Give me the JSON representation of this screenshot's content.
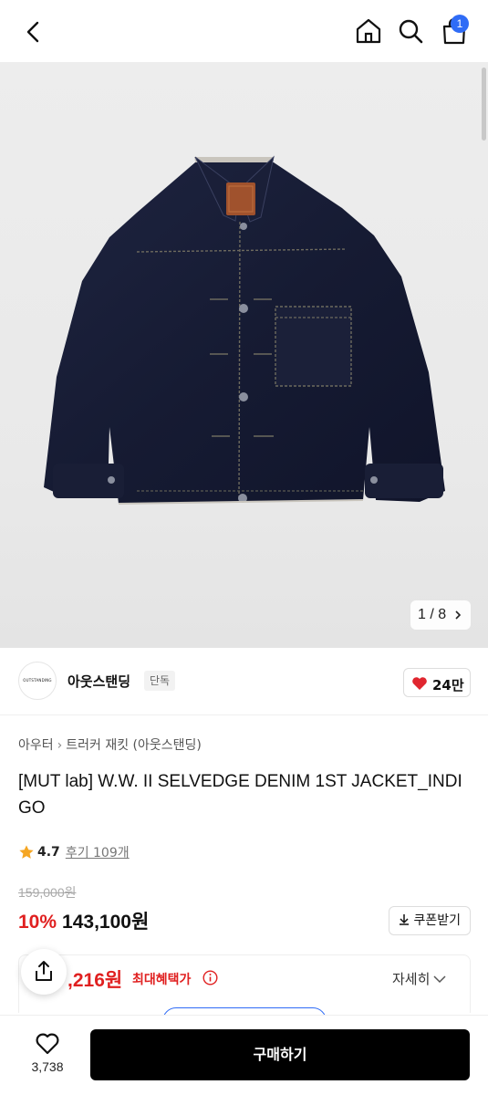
{
  "header": {
    "back_icon": "chevron-left-icon",
    "home_icon": "home-icon",
    "search_icon": "search-icon",
    "cart_icon": "shopping-bag-icon",
    "cart_count": "1",
    "badge_color": "#2f6cf6"
  },
  "gallery": {
    "pager": "1 / 8"
  },
  "brand": {
    "logo_text": "OUTSTANDING",
    "name": "아웃스탠딩",
    "tag": "단독",
    "likes": "24만",
    "heart_color": "#e0262f"
  },
  "product": {
    "breadcrumb": [
      "아우터",
      "트러커 재킷 (아웃스탠딩)"
    ],
    "title": "[MUT lab] W.W. II SELVEDGE DENIM 1ST JACKET_INDIGO",
    "rating": "4.7",
    "reviews": "후기 109개",
    "original_price": "159,000원",
    "discount": "10%",
    "sale_price": "143,100원",
    "coupon_label": "쿠폰받기",
    "benefit_price": ",216원",
    "benefit_label": "최대혜택가",
    "detail_label": "자세히",
    "accent_color": "#e02020"
  },
  "bottom": {
    "wishlist_count": "3,738",
    "buy_label": "구매하기"
  }
}
